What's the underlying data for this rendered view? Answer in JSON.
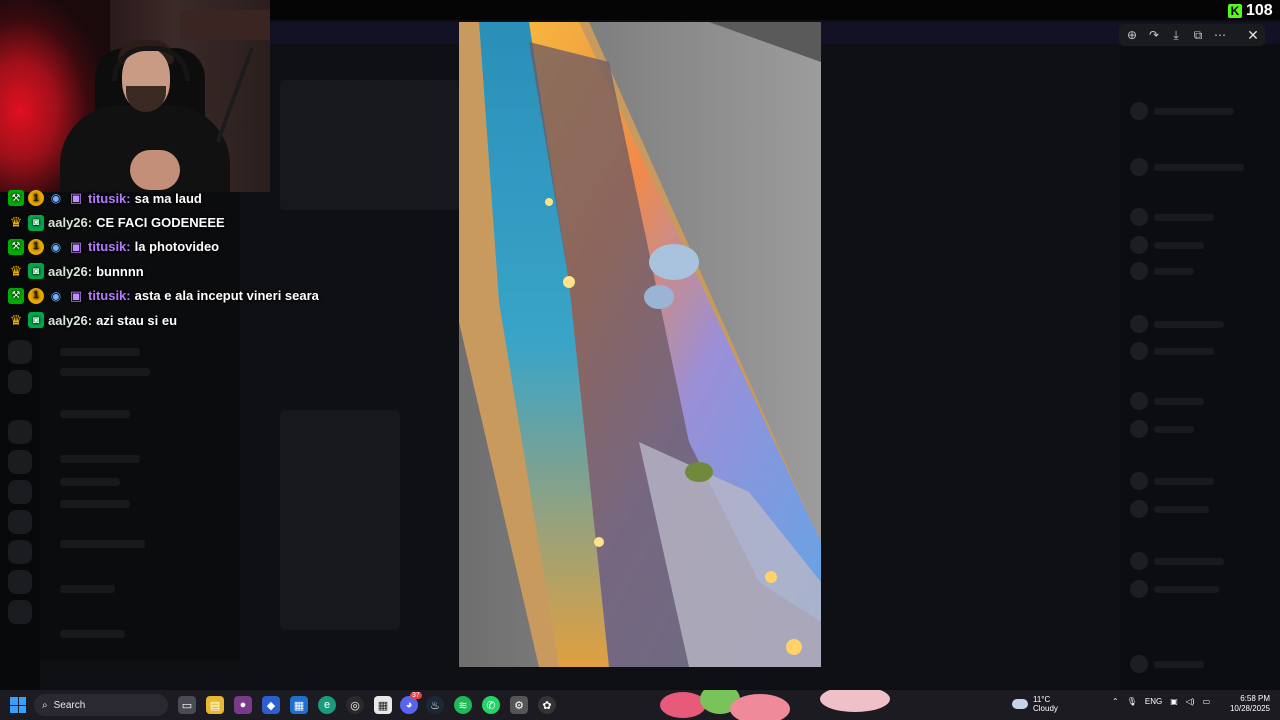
{
  "kick": {
    "viewer_count": "108",
    "logo_letter": "K"
  },
  "chat": {
    "messages": [
      {
        "user": "titusik:",
        "text": "sa ma laud",
        "color": "purple"
      },
      {
        "user": "aaly26:",
        "text": "CE FACI GODENEEE",
        "color": "green"
      },
      {
        "user": "titusik:",
        "text": "la photovideo",
        "color": "purple"
      },
      {
        "user": "aaly26:",
        "text": "bunnnn",
        "color": "green"
      },
      {
        "user": "titusik:",
        "text": "asta e ala inceput vineri seara",
        "color": "purple"
      },
      {
        "user": "aaly26:",
        "text": "azi stau si eu",
        "color": "green"
      }
    ],
    "badge_one": "1"
  },
  "viewer": {
    "toolbar": [
      "zoom-icon",
      "forward-icon",
      "download-icon",
      "open-external-icon",
      "more-icon"
    ],
    "close_icon": "close-icon"
  },
  "taskbar": {
    "search_label": "Search",
    "weather_temp": "11°C",
    "weather_desc": "Cloudy",
    "language": "ENG",
    "time": "6:58 PM",
    "date": "10/28/2025",
    "discord_badge": "37"
  },
  "colors": {
    "accent_kick": "#53fc18",
    "purple_user": "#b57bff",
    "taskbar": "#1c1b22"
  }
}
